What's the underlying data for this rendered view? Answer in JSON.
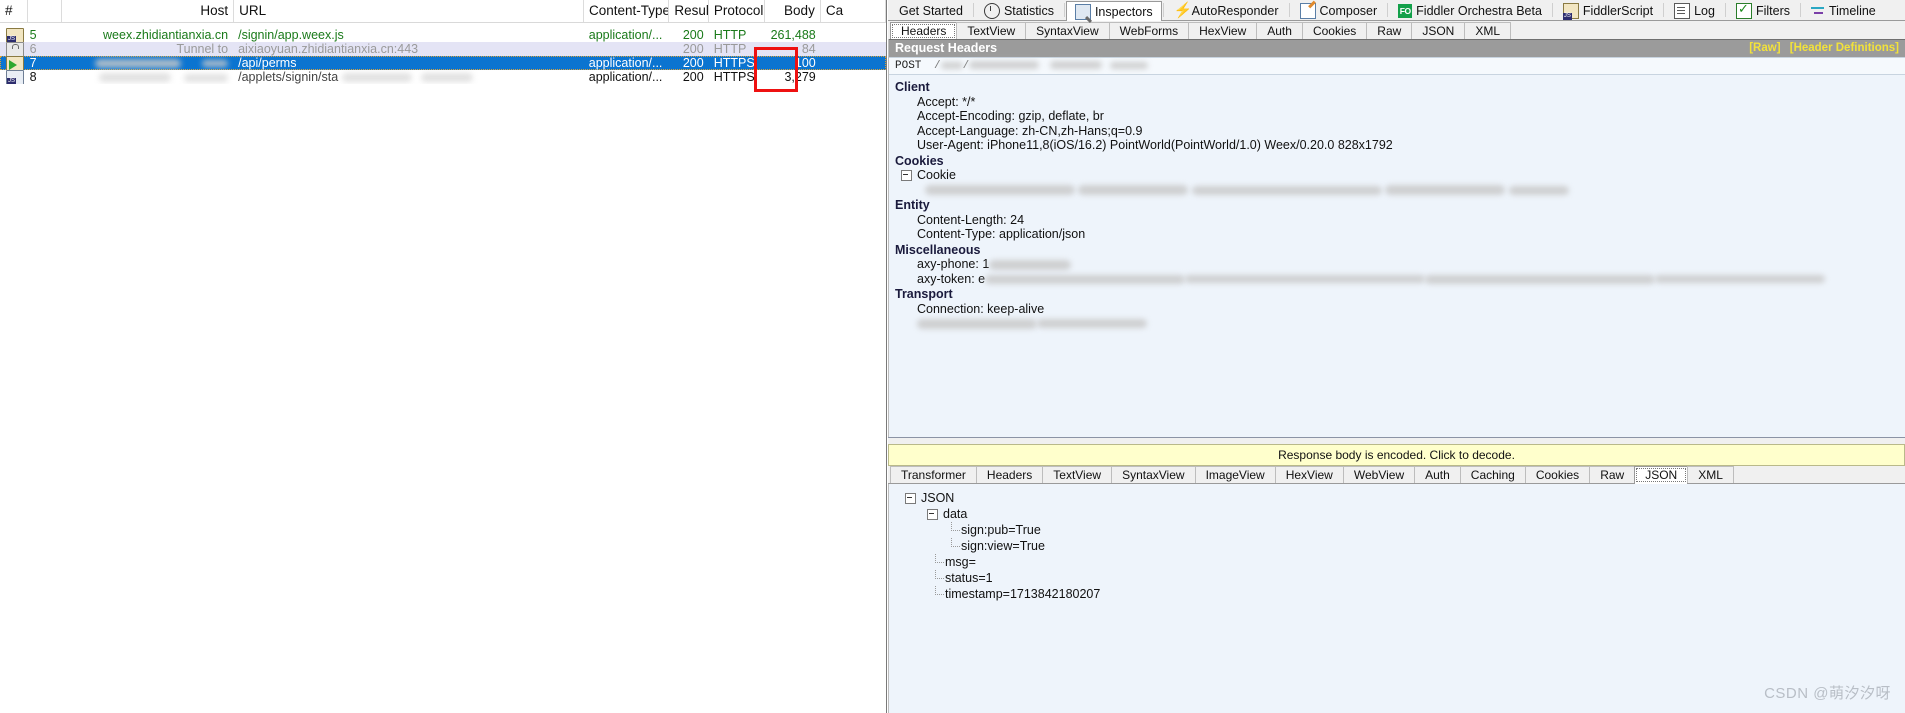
{
  "sessions": {
    "columns": [
      "#",
      "",
      "Host",
      "URL",
      "Content-Type",
      "Result",
      "Protocol",
      "Body",
      "Ca"
    ],
    "rows": [
      {
        "icon": "js-file-icon",
        "num": "5",
        "host": "weex.zhidiantianxia.cn",
        "url": "/signin/app.weex.js",
        "content_type": "application/...",
        "result": "200",
        "protocol": "HTTP",
        "body": "261,488",
        "caching": "",
        "style": "js"
      },
      {
        "icon": "lock-tunnel-icon",
        "num": "6",
        "host": "Tunnel to",
        "url": "aixiaoyuan.zhidiantianxia.cn:443",
        "content_type": "",
        "result": "200",
        "protocol": "HTTP",
        "body": "84",
        "caching": "",
        "style": "tunnel"
      },
      {
        "icon": "request-arrow-icon",
        "num": "7",
        "host": "",
        "url": "/api/perms",
        "content_type": "application/...",
        "result": "200",
        "protocol": "HTTPS",
        "body": "100",
        "caching": "",
        "style": "selected"
      },
      {
        "icon": "js-script-icon",
        "num": "8",
        "host": "",
        "url": "",
        "content_type": "application/...",
        "result": "200",
        "protocol": "HTTPS",
        "body": "3,279",
        "caching": "",
        "style": "plain"
      }
    ],
    "annotation": {
      "name": "red-highlight-box",
      "color": "#ee1111"
    }
  },
  "main_tabs": [
    {
      "label": "Get Started",
      "icon": "",
      "active": false
    },
    {
      "label": "Statistics",
      "icon": "clock-icon",
      "active": false
    },
    {
      "label": "Inspectors",
      "icon": "inspector-icon",
      "active": true
    },
    {
      "label": "AutoResponder",
      "icon": "bolt-icon",
      "active": false
    },
    {
      "label": "Composer",
      "icon": "compose-icon",
      "active": false
    },
    {
      "label": "Fiddler Orchestra Beta",
      "icon": "fo-badge-icon",
      "active": false
    },
    {
      "label": "FiddlerScript",
      "icon": "js-file-icon",
      "active": false
    },
    {
      "label": "Log",
      "icon": "log-icon",
      "active": false
    },
    {
      "label": "Filters",
      "icon": "filter-check-icon",
      "active": false
    },
    {
      "label": "Timeline",
      "icon": "timeline-icon",
      "active": false
    }
  ],
  "request": {
    "tabs": [
      {
        "label": "Headers",
        "active": true
      },
      {
        "label": "TextView",
        "active": false
      },
      {
        "label": "SyntaxView",
        "active": false
      },
      {
        "label": "WebForms",
        "active": false
      },
      {
        "label": "HexView",
        "active": false
      },
      {
        "label": "Auth",
        "active": false
      },
      {
        "label": "Cookies",
        "active": false
      },
      {
        "label": "Raw",
        "active": false
      },
      {
        "label": "JSON",
        "active": false
      },
      {
        "label": "XML",
        "active": false
      }
    ],
    "title": "Request Headers",
    "link_raw": "[Raw]",
    "link_defs": "[Header Definitions]",
    "request_line_method": "POST",
    "groups": [
      {
        "name": "Client",
        "items": [
          "Accept: */*",
          "Accept-Encoding: gzip, deflate, br",
          "Accept-Language: zh-CN,zh-Hans;q=0.9",
          "User-Agent: iPhone11,8(iOS/16.2) PointWorld(PointWorld/1.0) Weex/0.20.0 828x1792"
        ]
      },
      {
        "name": "Cookies",
        "node": "Cookie",
        "items": []
      },
      {
        "name": "Entity",
        "items": [
          "Content-Length: 24",
          "Content-Type: application/json"
        ]
      },
      {
        "name": "Miscellaneous",
        "items": [
          "axy-phone: 1",
          "axy-token: e"
        ]
      },
      {
        "name": "Transport",
        "items": [
          "Connection: keep-alive"
        ]
      }
    ]
  },
  "response": {
    "notice": "Response body is encoded. Click to decode.",
    "tabs": [
      {
        "label": "Transformer",
        "active": false
      },
      {
        "label": "Headers",
        "active": false
      },
      {
        "label": "TextView",
        "active": false
      },
      {
        "label": "SyntaxView",
        "active": false
      },
      {
        "label": "ImageView",
        "active": false
      },
      {
        "label": "HexView",
        "active": false
      },
      {
        "label": "WebView",
        "active": false
      },
      {
        "label": "Auth",
        "active": false
      },
      {
        "label": "Caching",
        "active": false
      },
      {
        "label": "Cookies",
        "active": false
      },
      {
        "label": "Raw",
        "active": false
      },
      {
        "label": "JSON",
        "active": true
      },
      {
        "label": "XML",
        "active": false
      }
    ],
    "json_tree": {
      "root": "JSON",
      "data_node": "data",
      "data_children": [
        "sign:pub=True",
        "sign:view=True"
      ],
      "siblings": [
        "msg=",
        "status=1",
        "timestamp=1713842180207"
      ]
    }
  },
  "watermark": "CSDN @萌汐汐呀"
}
